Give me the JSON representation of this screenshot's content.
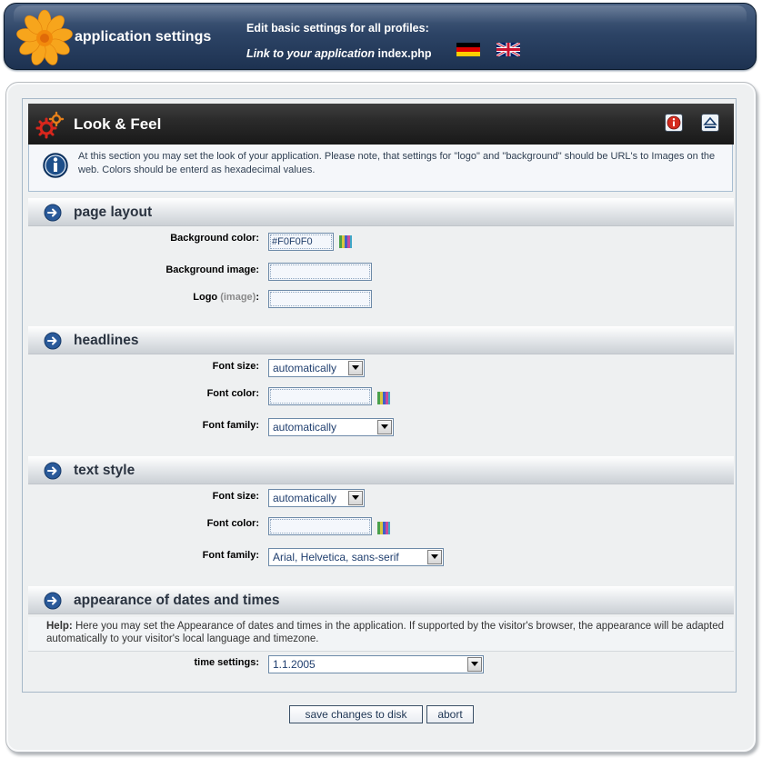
{
  "header": {
    "app_title": "application settings",
    "edit_text": "Edit basic settings for all profiles:",
    "link_label": "Link to your application",
    "link_target": "index.php",
    "languages": [
      "german",
      "english"
    ]
  },
  "section": {
    "title": "Look & Feel",
    "intro": "At this section you may set the look of your application. Please note, that settings for \"logo\" and \"background\" should be URL's to Images on the web. Colors should be enterd as hexadecimal values."
  },
  "page_layout": {
    "heading": "page layout",
    "bg_color_label": "Background color:",
    "bg_color_value": "#F0F0F0",
    "bg_image_label": "Background image:",
    "bg_image_value": "",
    "logo_label": "Logo",
    "logo_hint": "(image)",
    "logo_colon": ":",
    "logo_value": ""
  },
  "headlines": {
    "heading": "headlines",
    "font_size_label": "Font size:",
    "font_size_value": "automatically",
    "font_color_label": "Font color:",
    "font_color_value": "",
    "font_family_label": "Font family:",
    "font_family_value": "automatically"
  },
  "text_style": {
    "heading": "text style",
    "font_size_label": "Font size:",
    "font_size_value": "automatically",
    "font_color_label": "Font color:",
    "font_color_value": "",
    "font_family_label": "Font family:",
    "font_family_value": "Arial, Helvetica, sans-serif"
  },
  "dates": {
    "heading": "appearance of dates and times",
    "help_label": "Help:",
    "help_text": "Here you may set the Appearance of dates and times in the application. If supported by the visitor's browser, the appearance will be adapted automatically to your visitor's local language and timezone.",
    "time_label": "time settings:",
    "time_value": "1.1.2005"
  },
  "actions": {
    "save": "save changes to disk",
    "abort": "abort"
  },
  "colors": {
    "header_bg": "#2d4466",
    "section_header_bg": "#2b2b2b",
    "page_bg": "#eef0f1",
    "input_text": "#223f6a"
  }
}
